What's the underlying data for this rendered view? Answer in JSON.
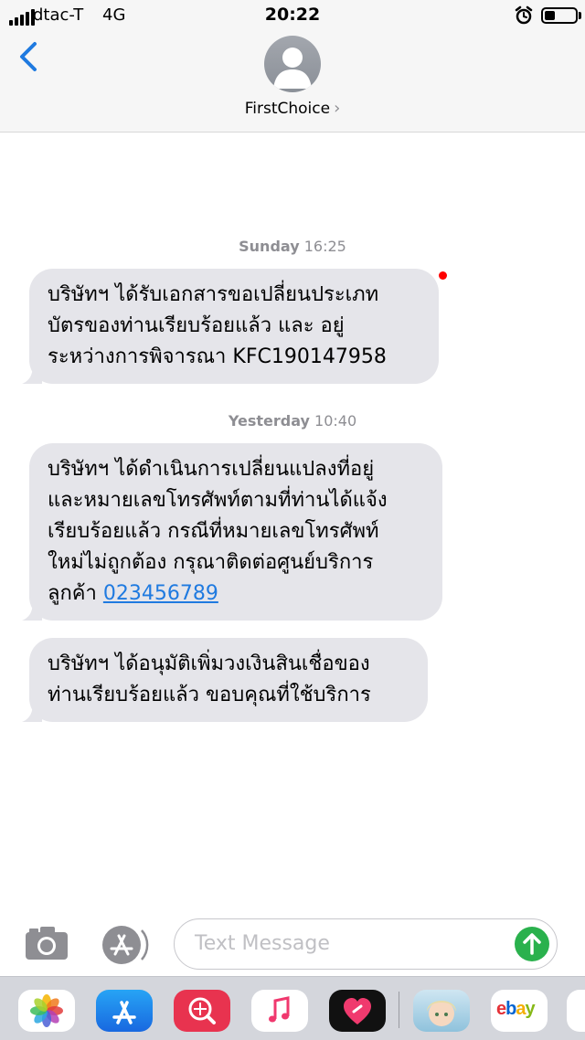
{
  "status_bar": {
    "carrier": "dtac-T",
    "network": "4G",
    "time": "20:22",
    "battery_level": 0.35
  },
  "header": {
    "contact_name": "FirstChoice",
    "chevron": "›"
  },
  "messages": [
    {
      "day": "Sunday",
      "time": "16:25",
      "lines": [
        "บริษัทฯ ได้รับเอกสารขอเปลี่ยนประเภท",
        "บัตรของท่านเรียบร้อยแล้ว และ อยู่",
        "ระหว่างการพิจารณา KFC190147958"
      ],
      "unread": true
    },
    {
      "day": "Yesterday",
      "time": "10:40",
      "lines": [
        "บริษัทฯ ได้ดำเนินการเปลี่ยนแปลงที่อยู่",
        "และหมายเลขโทรศัพท์ตามที่ท่านได้แจ้ง",
        "เรียบร้อยแล้ว กรณีที่หมายเลขโทรศัพท์",
        "ใหม่ไม่ถูกต้อง กรุณาติดต่อศูนย์บริการ"
      ],
      "last_line_prefix": "ลูกค้า",
      "phone_link": "023456789"
    },
    {
      "lines": [
        "บริษัทฯ ได้อนุมัติเพิ่มวงเงินสินเชื่อของ",
        "ท่านเรียบร้อยแล้ว ขอบคุณที่ใช้บริการ"
      ]
    }
  ],
  "input": {
    "placeholder": "Text Message"
  },
  "app_drawer": {
    "apps": [
      "photos-icon",
      "app-store-icon",
      "search-app-icon",
      "music-icon",
      "heart-app-icon",
      "game-avatar-icon",
      "ebay-icon"
    ],
    "ebay_label": "ebay"
  },
  "colors": {
    "bubble": "#e5e5ea",
    "link": "#1f7ae0",
    "send": "#2ab14d",
    "unread_dot": "#ff0000"
  }
}
